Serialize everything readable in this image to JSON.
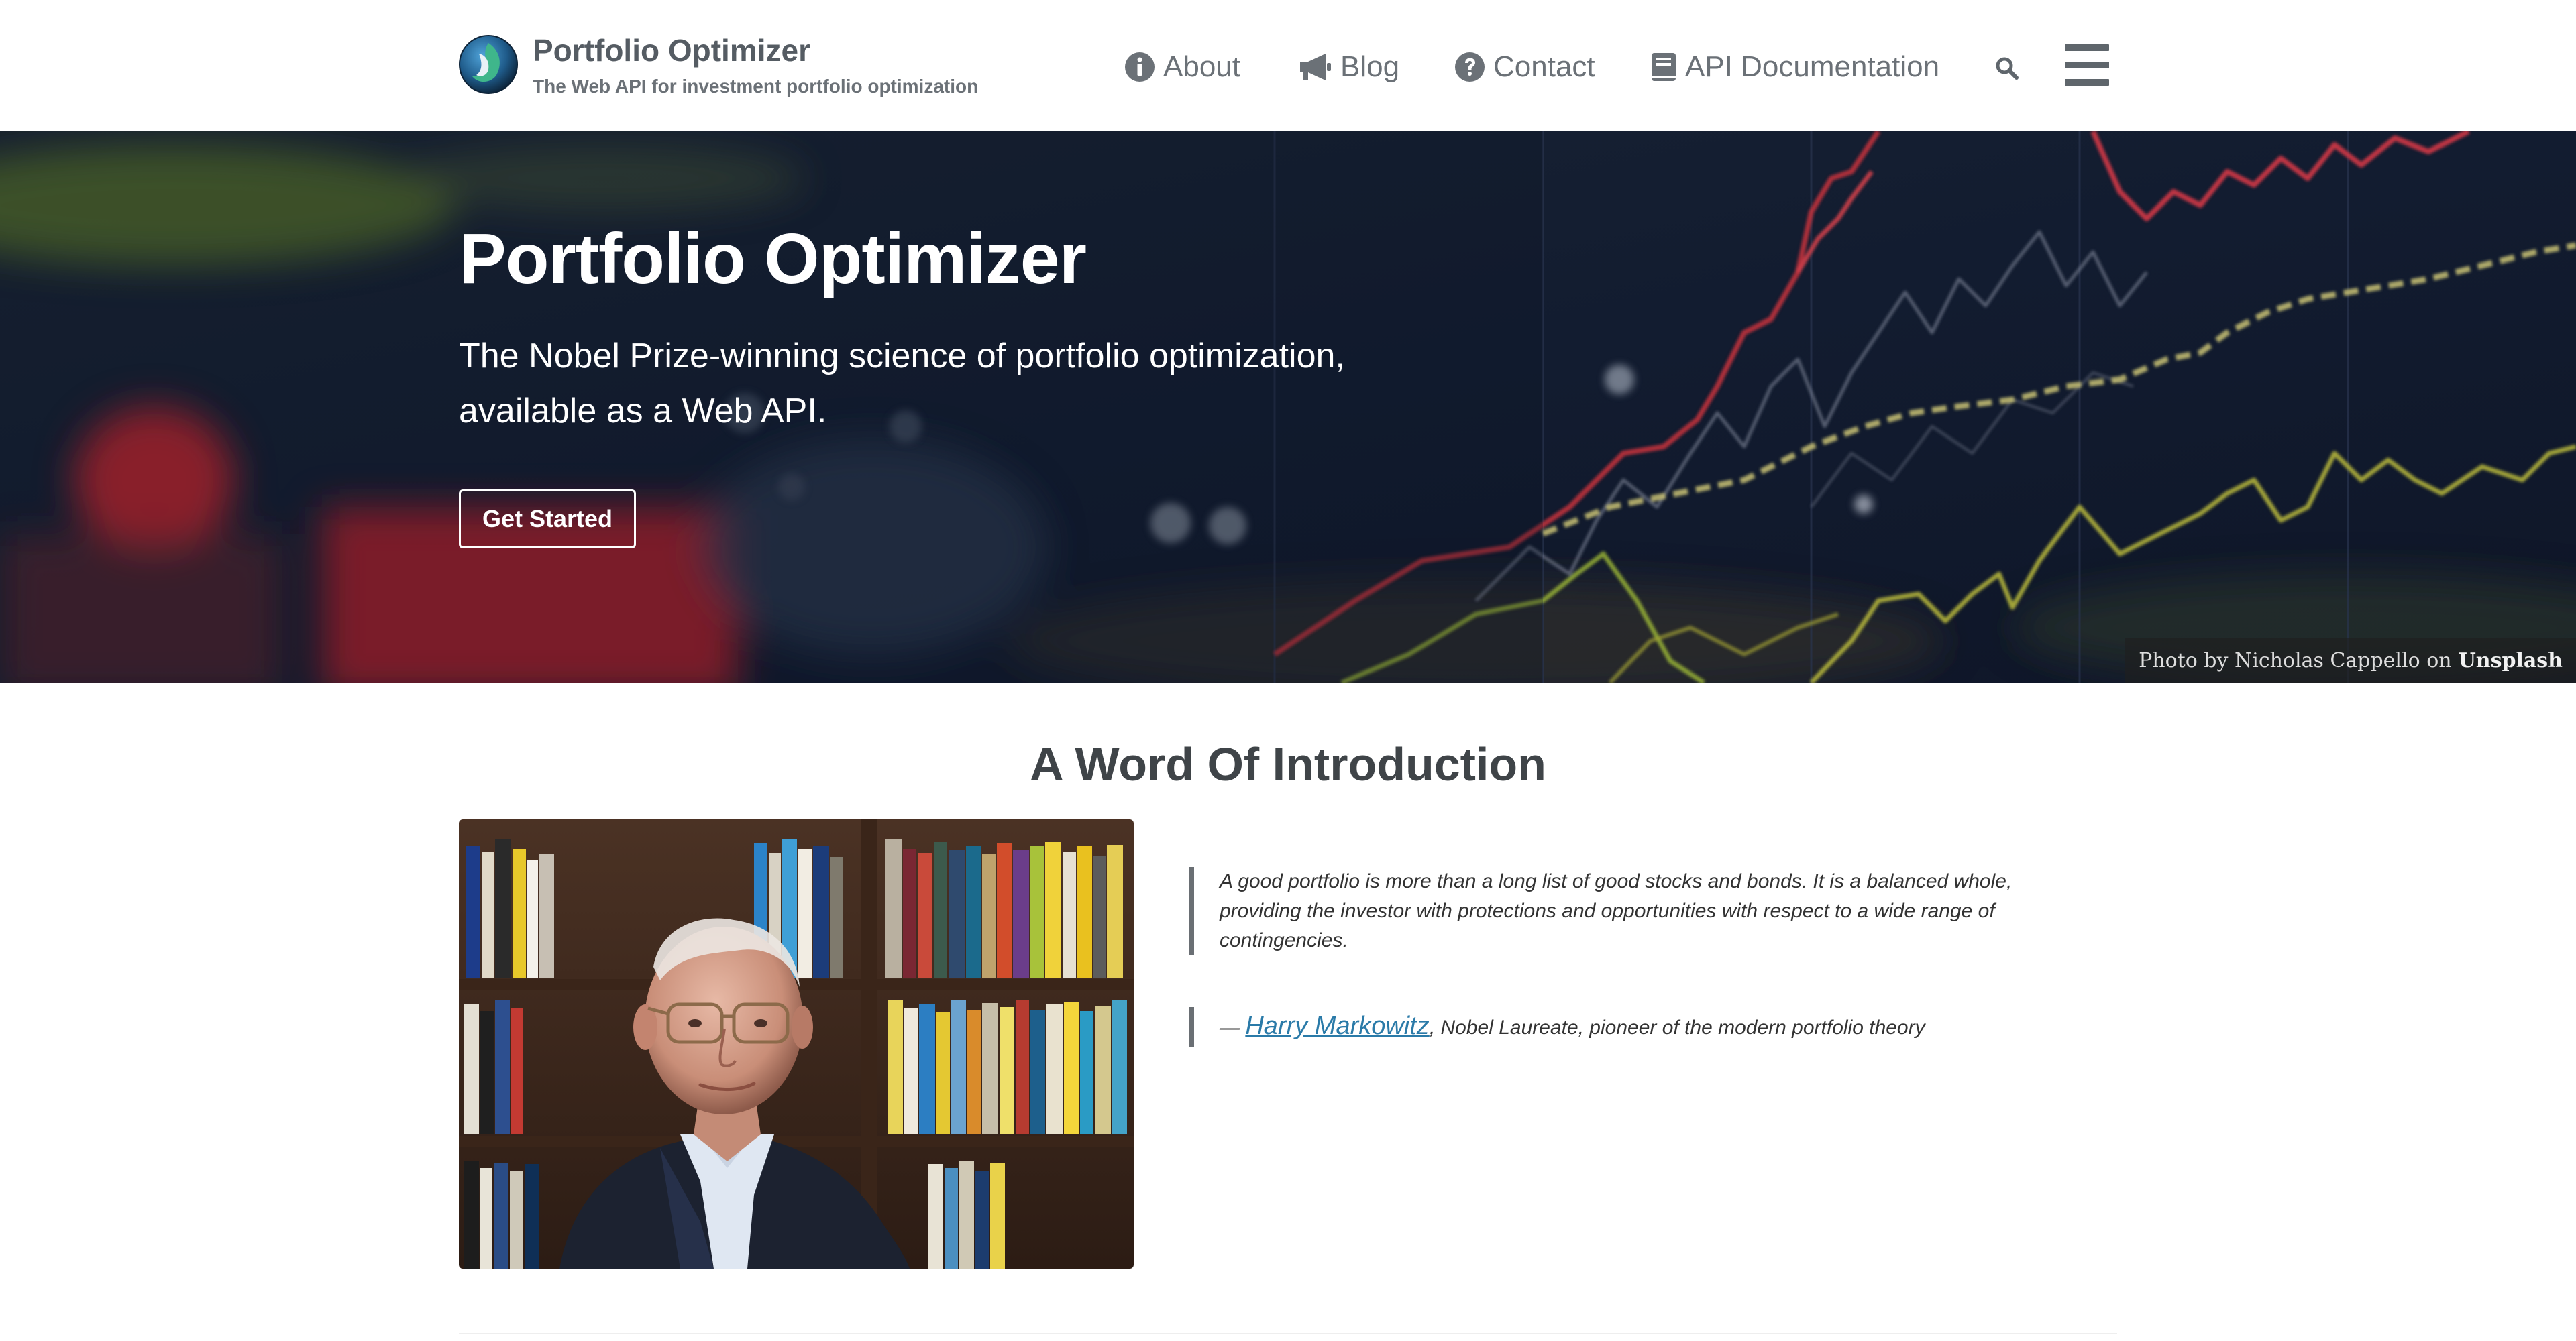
{
  "header": {
    "brand_title": "Portfolio Optimizer",
    "brand_subtitle": "The Web API for investment portfolio optimization",
    "nav": [
      {
        "label": "About",
        "icon": "info-circle-icon"
      },
      {
        "label": "Blog",
        "icon": "megaphone-icon"
      },
      {
        "label": "Contact",
        "icon": "question-circle-icon"
      },
      {
        "label": "API Documentation",
        "icon": "book-icon"
      }
    ],
    "search_icon": "search-icon",
    "menu_icon": "hamburger-menu-icon"
  },
  "hero": {
    "title": "Portfolio Optimizer",
    "tagline_line1": "The Nobel Prize-winning science of portfolio optimization,",
    "tagline_line2": "available as a Web API.",
    "cta_label": "Get Started",
    "credit_prefix": "Photo by Nicholas Cappello on",
    "credit_source": "Unsplash"
  },
  "intro": {
    "title": "A Word Of Introduction",
    "quote": "A good portfolio is more than a long list of good stocks and bonds. It is a balanced whole, providing the investor with protections and opportunities with respect to a wide range of contingencies.",
    "attribution_dash": "—",
    "attribution_name": "Harry Markowitz",
    "attribution_rest": ", Nobel Laureate, pioneer of the modern portfolio theory"
  },
  "colors": {
    "nav_text": "#6b7177",
    "link": "#2a7aa8",
    "hero_background": "#131d30"
  }
}
